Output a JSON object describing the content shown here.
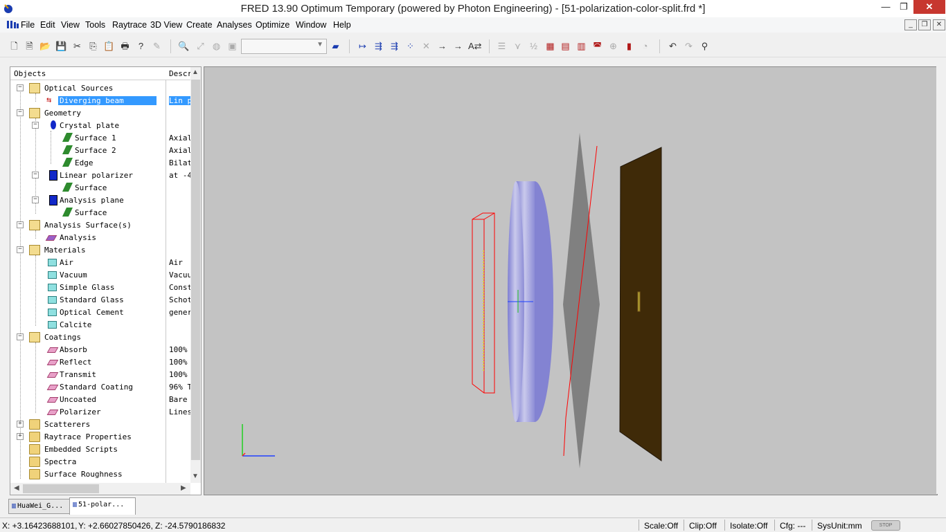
{
  "window": {
    "title": "FRED 13.90 Optimum Temporary (powered by Photon Engineering) - [51-polarization-color-split.frd *]",
    "minimize_icon": "minimize-icon",
    "restore_icon": "restore-icon",
    "close_icon": "close-icon"
  },
  "menubar": {
    "items": [
      "File",
      "Edit",
      "View",
      "Tools",
      "Raytrace",
      "3D View",
      "Create",
      "Analyses",
      "Optimize",
      "Window",
      "Help"
    ]
  },
  "tree": {
    "header_objects": "Objects",
    "header_desc": "Descr",
    "rows": [
      {
        "label": "Optical Sources",
        "desc": "",
        "icon": "folder-open-icon"
      },
      {
        "label": "Diverging beam",
        "desc": "Lin p",
        "icon": "source-icon"
      },
      {
        "label": "Geometry",
        "desc": "",
        "icon": "folder-open-icon"
      },
      {
        "label": "Crystal plate",
        "desc": "",
        "icon": "crystal-icon"
      },
      {
        "label": "Surface 1",
        "desc": "Axial",
        "icon": "surface-icon"
      },
      {
        "label": "Surface 2",
        "desc": "Axial",
        "icon": "surface-icon"
      },
      {
        "label": "Edge",
        "desc": "Bilat",
        "icon": "surface-icon"
      },
      {
        "label": "Linear polarizer",
        "desc": "at -4",
        "icon": "element-icon"
      },
      {
        "label": "Surface",
        "desc": "",
        "icon": "surface-icon"
      },
      {
        "label": "Analysis plane",
        "desc": "",
        "icon": "element-icon"
      },
      {
        "label": "Surface",
        "desc": "",
        "icon": "surface-icon"
      },
      {
        "label": "Analysis Surface(s)",
        "desc": "",
        "icon": "folder-open-icon"
      },
      {
        "label": "Analysis",
        "desc": "",
        "icon": "analysis-icon"
      },
      {
        "label": "Materials",
        "desc": "",
        "icon": "folder-open-icon"
      },
      {
        "label": "Air",
        "desc": "Air",
        "icon": "material-icon"
      },
      {
        "label": "Vacuum",
        "desc": "Vacuu",
        "icon": "material-icon"
      },
      {
        "label": "Simple Glass",
        "desc": "Const",
        "icon": "material-icon"
      },
      {
        "label": "Standard Glass",
        "desc": "Schot",
        "icon": "material-icon"
      },
      {
        "label": "Optical Cement",
        "desc": "gener",
        "icon": "material-icon"
      },
      {
        "label": "Calcite",
        "desc": "",
        "icon": "material-icon"
      },
      {
        "label": "Coatings",
        "desc": "",
        "icon": "folder-open-icon"
      },
      {
        "label": "Absorb",
        "desc": "100%",
        "icon": "coating-icon"
      },
      {
        "label": "Reflect",
        "desc": "100%",
        "icon": "coating-icon"
      },
      {
        "label": "Transmit",
        "desc": "100%",
        "icon": "coating-icon"
      },
      {
        "label": "Standard Coating",
        "desc": "96% T",
        "icon": "coating-icon"
      },
      {
        "label": "Uncoated",
        "desc": "Bare",
        "icon": "coating-icon"
      },
      {
        "label": "Polarizer",
        "desc": "Lines",
        "icon": "coating-icon"
      },
      {
        "label": "Scatterers",
        "desc": "",
        "icon": "folder-icon"
      },
      {
        "label": "Raytrace Properties",
        "desc": "",
        "icon": "folder-icon"
      },
      {
        "label": "Embedded Scripts",
        "desc": "",
        "icon": "folder-icon"
      },
      {
        "label": "Spectra",
        "desc": "",
        "icon": "folder-icon"
      },
      {
        "label": "Surface Roughness",
        "desc": "",
        "icon": "folder-icon"
      }
    ]
  },
  "tabs": [
    {
      "label": "HuaWei_G..."
    },
    {
      "label": "51-polar..."
    }
  ],
  "status": {
    "x": "X: +3.16423688101,",
    "y": "Y: +2.66027850426,",
    "z": "Z: -24.5790186832",
    "scale": "Scale:Off",
    "clip": "Clip:Off",
    "isolate": "Isolate:Off",
    "cfg": "Cfg: ---",
    "sysunit": "SysUnit:mm",
    "stop_label": "STOP"
  },
  "colors": {
    "viewport_bg": "#c3c3c3",
    "selection": "#3399ff",
    "source_outline": "#ff0000",
    "crystal_plate": "#8f8fd8",
    "polarizer": "#808080",
    "analysis_plane": "#3f2a08"
  }
}
